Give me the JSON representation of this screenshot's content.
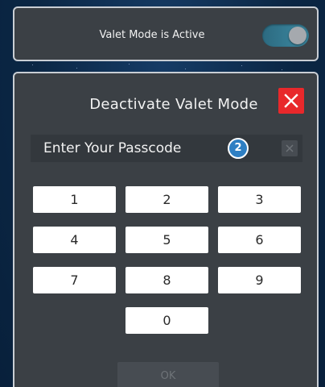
{
  "status_card": {
    "label": "Valet Mode is Active",
    "toggle_on": true
  },
  "dialog": {
    "title": "Deactivate Valet Mode",
    "close_icon": "close-x-icon",
    "passcode_label": "Enter Your Passcode",
    "step_badge": "2",
    "clear_icon": "clear-x-icon",
    "keys": [
      "1",
      "2",
      "3",
      "4",
      "5",
      "6",
      "7",
      "8",
      "9",
      "0"
    ],
    "ok_label": "OK",
    "ok_enabled": false
  },
  "colors": {
    "close_red": "#e8282b",
    "badge_blue": "#2e7fc3",
    "toggle_teal": "#3d8aa3",
    "panel_bg": "#3b4045"
  }
}
